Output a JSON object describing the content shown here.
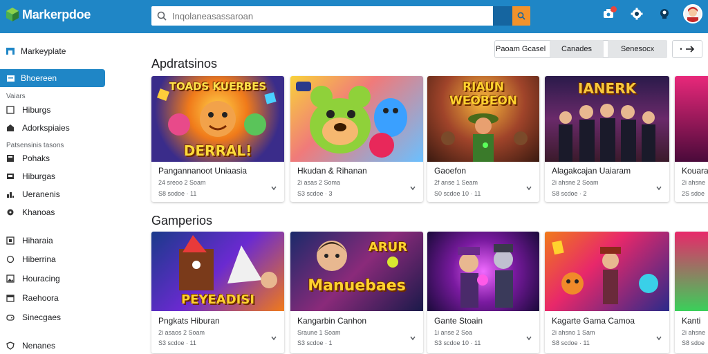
{
  "topbar": {
    "app_name": "Markerpdoe",
    "search_placeholder": "Inqolaneasassaroan",
    "colors": {
      "bar": "#1f86c6",
      "search_accent": "#f2922b"
    },
    "icons": [
      "notification-icon",
      "settings-icon",
      "help-icon",
      "user-avatar"
    ]
  },
  "sidebar": {
    "title": "Markeyplate",
    "active_item": "Bhoereen",
    "group1_label": "Vaiars",
    "group1_items": [
      "Hiburgs",
      "Adorkspiaies"
    ],
    "group2_label": "Patsensinis tasons",
    "group2_items": [
      "Pohaks",
      "Hiburgas",
      "Ueranenis",
      "Khanoas"
    ],
    "group3_items": [
      "Hiharaia",
      "Hiberrina",
      "Houracing",
      "Raehoora",
      "Sinecgaes"
    ],
    "footer_item": "Nenanes"
  },
  "toolbar": {
    "sort_label": "Paoam Gcasel",
    "button1": "Canades",
    "button2": "Senesocx"
  },
  "sections": [
    {
      "title": "Apdratsinos",
      "cards": [
        {
          "title": "Pangannanoot Uniaasia",
          "meta1": "24 sreoo 2 Soam",
          "meta2": "S8 sodoe · 11",
          "art_text": "DERRAL!",
          "art_top": "TOADS KUERBES"
        },
        {
          "title": "Hkudan & Rihanan",
          "meta1": "2i asas 2 Soma",
          "meta2": "S3 scdoe · 3",
          "art_text": "",
          "art_top": ""
        },
        {
          "title": "Gaoefon",
          "meta1": "2f anse 1 Seam",
          "meta2": "S0 scdoe 10 · 11",
          "art_text": "WEOBEON",
          "art_top": "RIAUN"
        },
        {
          "title": "Alagakcajan Uaiaram",
          "meta1": "2i ahsne 2 Soam",
          "meta2": "S8 scdoe · 2",
          "art_text": "",
          "art_top": "IANERK"
        },
        {
          "title": "Kouarai",
          "meta1": "2i ahsne",
          "meta2": "2S sdoe",
          "art_text": "",
          "art_top": ""
        }
      ]
    },
    {
      "title": "Gamperios",
      "cards": [
        {
          "title": "Pngkats Hiburan",
          "meta1": "2i asaos 2 Soam",
          "meta2": "S3 scdoe · 11",
          "art_text": "PEYEADISI",
          "art_top": ""
        },
        {
          "title": "Kangarbin Canhon",
          "meta1": "Sraune 1 Soam",
          "meta2": "S3 scdoe · 1",
          "art_text": "Manuebaes",
          "art_top": "ARUR"
        },
        {
          "title": "Gante Stoain",
          "meta1": "1i anse 2 Soa",
          "meta2": "S3 scdoe 10 · 11",
          "art_text": "",
          "art_top": ""
        },
        {
          "title": "Kagarte Gama Camoa",
          "meta1": "2i ahsno 1 Sam",
          "meta2": "S8 scdoe · 11",
          "art_text": "",
          "art_top": ""
        },
        {
          "title": "Kanti",
          "meta1": "2i ahsne",
          "meta2": "S8 sdoe",
          "art_text": "",
          "art_top": ""
        }
      ]
    }
  ]
}
